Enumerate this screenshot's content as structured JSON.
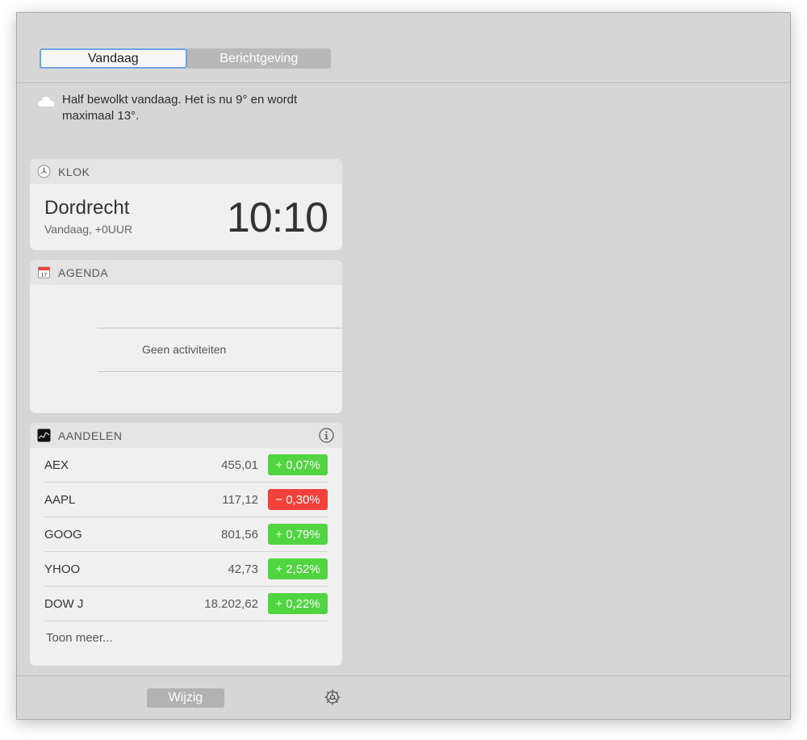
{
  "tabs": {
    "today": "Vandaag",
    "notifications": "Berichtgeving"
  },
  "weather": {
    "text": "Half bewolkt vandaag. Het is nu 9° en wordt maximaal 13°.",
    "icon": "cloud-icon"
  },
  "klok": {
    "title": "KLOK",
    "city": "Dordrecht",
    "subtitle": "Vandaag, +0UUR",
    "time": "10:10"
  },
  "agenda": {
    "title": "AGENDA",
    "empty": "Geen activiteiten",
    "icon_day": "17"
  },
  "aandelen": {
    "title": "AANDELEN",
    "stocks": [
      {
        "name": "AEX",
        "value": "455,01",
        "change": "+ 0,07%",
        "dir": "up"
      },
      {
        "name": "AAPL",
        "value": "117,12",
        "change": "− 0,30%",
        "dir": "down"
      },
      {
        "name": "GOOG",
        "value": "801,56",
        "change": "+ 0,79%",
        "dir": "up"
      },
      {
        "name": "YHOO",
        "value": "42,73",
        "change": "+ 2,52%",
        "dir": "up"
      },
      {
        "name": "DOW J",
        "value": "18.202,62",
        "change": "+ 0,22%",
        "dir": "up"
      }
    ],
    "show_more": "Toon meer..."
  },
  "footer": {
    "edit": "Wijzig"
  },
  "colors": {
    "up": "#50d43f",
    "down": "#f2413b",
    "accent": "#6fa2e0"
  }
}
